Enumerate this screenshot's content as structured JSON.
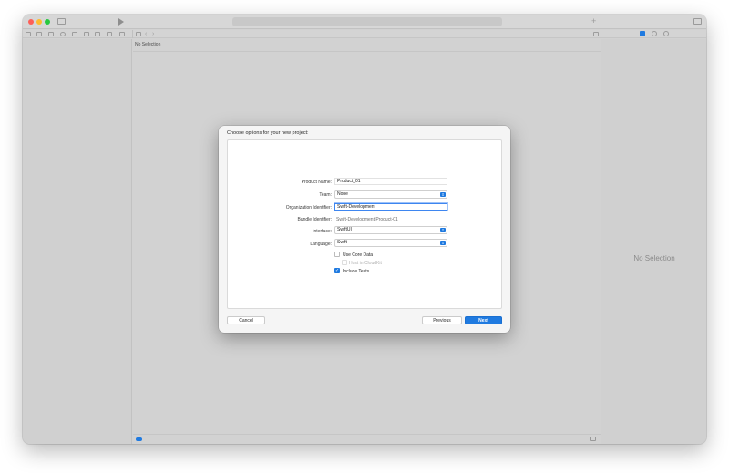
{
  "editor": {
    "jumpbar_text": "No Selection"
  },
  "inspector": {
    "empty_text": "No Selection"
  },
  "toolbar": {
    "add_symbol": "+"
  },
  "dialog": {
    "heading": "Choose options for your new project:",
    "fields": {
      "product_name": {
        "label": "Product Name:",
        "value": "Product_01"
      },
      "team": {
        "label": "Team:",
        "value": "None"
      },
      "organization_identifier": {
        "label": "Organization Identifier:",
        "value": "Swift-Development"
      },
      "bundle_identifier": {
        "label": "Bundle Identifier:",
        "value": "Swift-Development.Product-01"
      },
      "interface": {
        "label": "Interface:",
        "value": "SwiftUI"
      },
      "language": {
        "label": "Language:",
        "value": "Swift"
      }
    },
    "checkboxes": {
      "use_core_data": {
        "label": "Use Core Data",
        "checked": false
      },
      "host_in_cloudkit": {
        "label": "Host in CloudKit",
        "checked": false,
        "enabled": false
      },
      "include_tests": {
        "label": "Include Tests",
        "checked": true
      }
    },
    "buttons": {
      "cancel": "Cancel",
      "previous": "Previous",
      "next": "Next"
    }
  },
  "colors": {
    "accent": "#1f7ae0",
    "close": "#fd5f57",
    "minimize": "#febc2e",
    "zoom": "#28c840"
  }
}
